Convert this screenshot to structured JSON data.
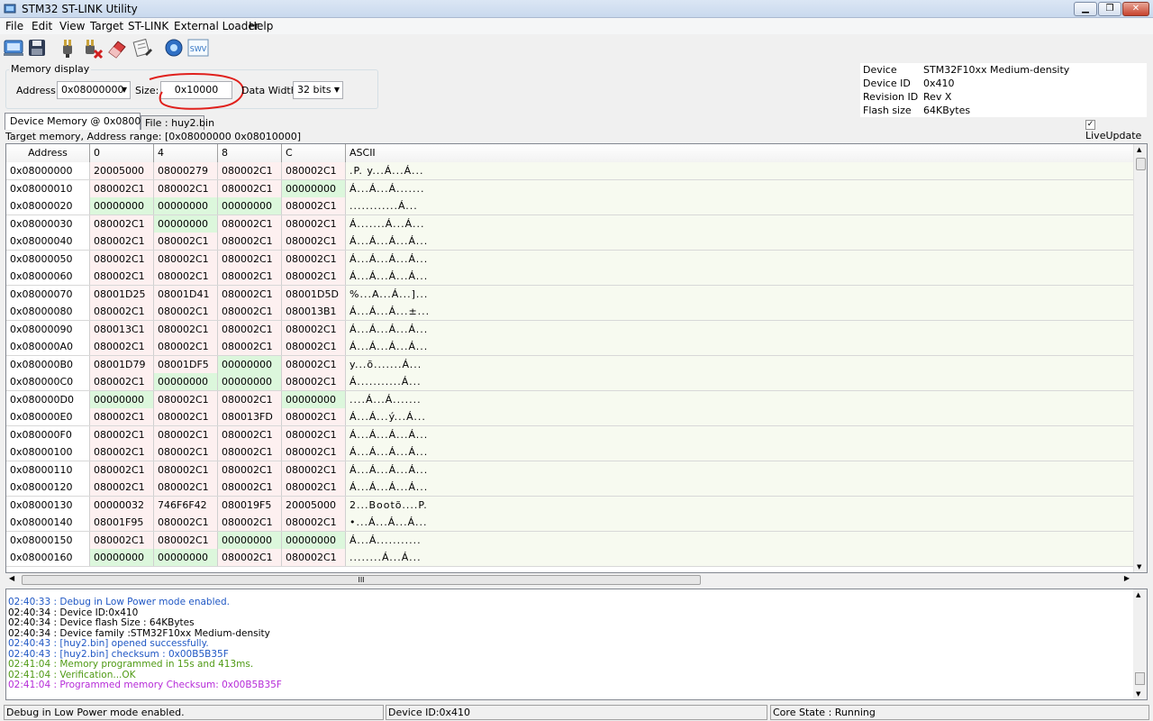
{
  "window": {
    "title": "STM32 ST-LINK Utility"
  },
  "menu": [
    "File",
    "Edit",
    "View",
    "Target",
    "ST-LINK",
    "External Loader",
    "Help"
  ],
  "toolbar_icons": [
    "connect-icon",
    "save-icon",
    "plug-icon",
    "disconnect-icon",
    "erase-icon",
    "program-icon",
    "settings-icon",
    "swv-icon"
  ],
  "memory_display": {
    "group_label": "Memory display",
    "address_label": "Address:",
    "address_value": "0x08000000",
    "size_label": "Size:",
    "size_value": "0x10000",
    "width_label": "Data Width:",
    "width_value": "32 bits"
  },
  "device_info": [
    {
      "key": "Device",
      "value": "STM32F10xx Medium-density"
    },
    {
      "key": "Device ID",
      "value": "0x410"
    },
    {
      "key": "Revision ID",
      "value": "Rev X"
    },
    {
      "key": "Flash size",
      "value": "64KBytes"
    }
  ],
  "live_update": {
    "label": "LiveUpdate",
    "checked": true
  },
  "tabs": {
    "device_memory": "Device Memory @ 0x08000000 :",
    "file": "File : huy2.bin"
  },
  "range_text": "Target memory, Address range: [0x08000000 0x08010000]",
  "grid": {
    "headers": [
      "Address",
      "0",
      "4",
      "8",
      "C",
      "ASCII"
    ],
    "rows": [
      [
        "0x08000000",
        "20005000",
        "08000279",
        "080002C1",
        "080002C1",
        ".P. y...Á...Á..."
      ],
      [
        "0x08000010",
        "080002C1",
        "080002C1",
        "080002C1",
        "00000000",
        "Á...Á...Á......."
      ],
      [
        "0x08000020",
        "00000000",
        "00000000",
        "00000000",
        "080002C1",
        "............Á..."
      ],
      [
        "0x08000030",
        "080002C1",
        "00000000",
        "080002C1",
        "080002C1",
        "Á.......Á...Á..."
      ],
      [
        "0x08000040",
        "080002C1",
        "080002C1",
        "080002C1",
        "080002C1",
        "Á...Á...Á...Á..."
      ],
      [
        "0x08000050",
        "080002C1",
        "080002C1",
        "080002C1",
        "080002C1",
        "Á...Á...Á...Á..."
      ],
      [
        "0x08000060",
        "080002C1",
        "080002C1",
        "080002C1",
        "080002C1",
        "Á...Á...Á...Á..."
      ],
      [
        "0x08000070",
        "08001D25",
        "08001D41",
        "080002C1",
        "08001D5D",
        "%...A...Á...]..."
      ],
      [
        "0x08000080",
        "080002C1",
        "080002C1",
        "080002C1",
        "080013B1",
        "Á...Á...Á...±..."
      ],
      [
        "0x08000090",
        "080013C1",
        "080002C1",
        "080002C1",
        "080002C1",
        "Á...Á...Á...Á..."
      ],
      [
        "0x080000A0",
        "080002C1",
        "080002C1",
        "080002C1",
        "080002C1",
        "Á...Á...Á...Á..."
      ],
      [
        "0x080000B0",
        "08001D79",
        "08001DF5",
        "00000000",
        "080002C1",
        "y...õ.......Á..."
      ],
      [
        "0x080000C0",
        "080002C1",
        "00000000",
        "00000000",
        "080002C1",
        "Á...........Á..."
      ],
      [
        "0x080000D0",
        "00000000",
        "080002C1",
        "080002C1",
        "00000000",
        "....Á...Á......."
      ],
      [
        "0x080000E0",
        "080002C1",
        "080002C1",
        "080013FD",
        "080002C1",
        "Á...Á...ý...Á..."
      ],
      [
        "0x080000F0",
        "080002C1",
        "080002C1",
        "080002C1",
        "080002C1",
        "Á...Á...Á...Á..."
      ],
      [
        "0x08000100",
        "080002C1",
        "080002C1",
        "080002C1",
        "080002C1",
        "Á...Á...Á...Á..."
      ],
      [
        "0x08000110",
        "080002C1",
        "080002C1",
        "080002C1",
        "080002C1",
        "Á...Á...Á...Á..."
      ],
      [
        "0x08000120",
        "080002C1",
        "080002C1",
        "080002C1",
        "080002C1",
        "Á...Á...Á...Á..."
      ],
      [
        "0x08000130",
        "00000032",
        "746F6F42",
        "080019F5",
        "20005000",
        "2...Bootõ....P."
      ],
      [
        "0x08000140",
        "08001F95",
        "080002C1",
        "080002C1",
        "080002C1",
        "•...Á...Á...Á..."
      ],
      [
        "0x08000150",
        "080002C1",
        "080002C1",
        "00000000",
        "00000000",
        "Á...Á..........."
      ],
      [
        "0x08000160",
        "00000000",
        "00000000",
        "080002C1",
        "080002C1",
        "........Á...Á..."
      ]
    ]
  },
  "hscroll_label": "III",
  "log": [
    {
      "text": "02:40:33 : Debug in Low Power mode enabled.",
      "color": "#1f57c4"
    },
    {
      "text": "02:40:34 : Device ID:0x410",
      "color": "#000000"
    },
    {
      "text": "02:40:34 : Device flash Size : 64KBytes",
      "color": "#000000"
    },
    {
      "text": "02:40:34 : Device family :STM32F10xx Medium-density",
      "color": "#000000"
    },
    {
      "text": "02:40:43 : [huy2.bin] opened successfully.",
      "color": "#1f57c4"
    },
    {
      "text": "02:40:43 : [huy2.bin] checksum : 0x00B5B35F",
      "color": "#1f57c4"
    },
    {
      "text": "02:41:04 : Memory programmed in 15s and 413ms.",
      "color": "#4f9a14"
    },
    {
      "text": "02:41:04 : Verification...OK",
      "color": "#4f9a14"
    },
    {
      "text": "02:41:04 : Programmed memory Checksum: 0x00B5B35F",
      "color": "#b62bd8"
    }
  ],
  "status": {
    "left": "Debug in Low Power mode enabled.",
    "middle": "Device ID:0x410",
    "right": "Core State : Running"
  },
  "colors": {
    "annotation": "#e0201c",
    "zero_cell": "#dcf7dc",
    "data_cell": "#fdf0f0"
  }
}
